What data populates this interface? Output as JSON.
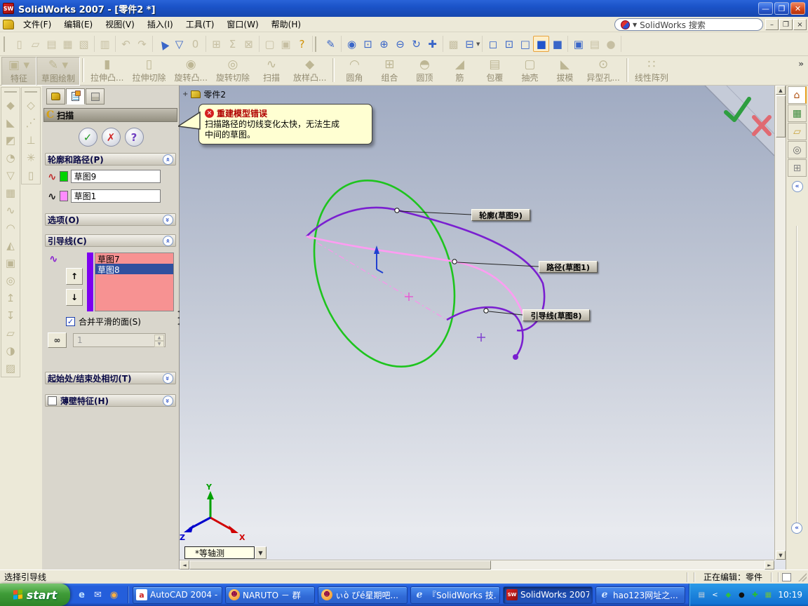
{
  "window": {
    "title": "SolidWorks 2007 - [零件2 *]",
    "logo_text": "SW"
  },
  "menubar": {
    "items": [
      "文件(F)",
      "编辑(E)",
      "视图(V)",
      "插入(I)",
      "工具(T)",
      "窗口(W)",
      "帮助(H)"
    ],
    "search_placeholder": "SolidWorks 搜索",
    "mdi_buttons": [
      "–",
      "❐",
      "×"
    ],
    "caption_buttons": [
      "–",
      "❐",
      "×"
    ]
  },
  "standard_toolbar": {
    "groups": [
      {
        "grip": true,
        "icons": [
          {
            "n": "new-document",
            "g": "▯",
            "s": "d"
          },
          {
            "n": "open",
            "g": "▱",
            "s": "d"
          },
          {
            "n": "save",
            "g": "▤",
            "s": "d"
          },
          {
            "n": "make-drawing",
            "g": "▦",
            "s": "d"
          },
          {
            "n": "make-assembly",
            "g": "▧",
            "s": "d"
          }
        ]
      },
      {
        "icons": [
          {
            "n": "print",
            "g": "▥",
            "s": "d"
          }
        ]
      },
      {
        "icons": [
          {
            "n": "undo",
            "g": "↶",
            "s": "d"
          },
          {
            "n": "redo",
            "g": "↷",
            "s": "d"
          }
        ]
      },
      {
        "icons": [
          {
            "n": "select",
            "g": "▲",
            "s": "e",
            "r": -35
          },
          {
            "n": "selection-filter",
            "g": "▽",
            "s": "e"
          },
          {
            "n": "toggle-selection-filter",
            "g": "0",
            "s": "d"
          }
        ]
      },
      {
        "icons": [
          {
            "n": "rebuild",
            "g": "⊞",
            "s": "d"
          },
          {
            "n": "equations",
            "g": "Σ",
            "s": "d"
          },
          {
            "n": "no-sketch",
            "g": "⊠",
            "s": "d"
          }
        ]
      },
      {
        "icons": [
          {
            "n": "options",
            "g": "▢",
            "s": "d"
          },
          {
            "n": "appearance",
            "g": "▣",
            "s": "d"
          },
          {
            "n": "help",
            "g": "?",
            "s": "y"
          }
        ]
      },
      {
        "grip": true,
        "icons": [
          {
            "n": "edit-color",
            "g": "✎",
            "s": "e"
          }
        ]
      },
      {
        "icons": [
          {
            "n": "zoom-to-fit",
            "g": "◉",
            "s": "e"
          },
          {
            "n": "zoom-to-area",
            "g": "⊡",
            "s": "e"
          },
          {
            "n": "zoom-in-out",
            "g": "⊕",
            "s": "e"
          },
          {
            "n": "zoom-to-selection",
            "g": "⊖",
            "s": "e"
          },
          {
            "n": "rotate-view",
            "g": "↻",
            "s": "e"
          },
          {
            "n": "pan",
            "g": "✚",
            "s": "e"
          }
        ]
      },
      {
        "icons": [
          {
            "n": "shadow",
            "g": "▩",
            "s": "d"
          },
          {
            "n": "view-orientation",
            "g": "⊟",
            "s": "e",
            "dd": true
          }
        ]
      },
      {
        "icons": [
          {
            "n": "wireframe",
            "g": "◻",
            "s": "e"
          },
          {
            "n": "hidden-lines-visible",
            "g": "⊡",
            "s": "e"
          },
          {
            "n": "hidden-lines-removed",
            "g": "□",
            "s": "e"
          },
          {
            "n": "shaded-with-edges",
            "g": "■",
            "s": "sel"
          },
          {
            "n": "shaded",
            "g": "■",
            "s": "e"
          }
        ]
      },
      {
        "icons": [
          {
            "n": "shadows-in-shaded",
            "g": "▣",
            "s": "e"
          },
          {
            "n": "appearance-book",
            "g": "▤",
            "s": "d"
          },
          {
            "n": "curvature",
            "g": "●",
            "s": "d"
          }
        ]
      }
    ]
  },
  "features_toolbar": {
    "items": [
      {
        "n": "features",
        "label": "特征",
        "g": "▣",
        "grp": true,
        "dd": true
      },
      {
        "n": "sketch",
        "label": "草图绘制",
        "g": "✎",
        "grp": true,
        "dd": true
      },
      {
        "sep": true
      },
      {
        "n": "extruded-boss",
        "label": "拉伸凸...",
        "g": "▮"
      },
      {
        "n": "extruded-cut",
        "label": "拉伸切除",
        "g": "▯"
      },
      {
        "n": "revolved-boss",
        "label": "旋转凸...",
        "g": "◉"
      },
      {
        "n": "revolved-cut",
        "label": "旋转切除",
        "g": "◎"
      },
      {
        "n": "sweep",
        "label": "扫描",
        "g": "∿"
      },
      {
        "n": "loft",
        "label": "放样凸...",
        "g": "◆"
      },
      {
        "sep": true
      },
      {
        "n": "fillet",
        "label": "圆角",
        "g": "◠"
      },
      {
        "n": "combine",
        "label": "组合",
        "g": "⊞"
      },
      {
        "n": "dome",
        "label": "圆顶",
        "g": "◓"
      },
      {
        "n": "rib",
        "label": "筋",
        "g": "◢"
      },
      {
        "n": "wrap",
        "label": "包覆",
        "g": "▤"
      },
      {
        "n": "shell",
        "label": "抽壳",
        "g": "▢"
      },
      {
        "n": "draft",
        "label": "拔模",
        "g": "◣"
      },
      {
        "n": "hole-wizard",
        "label": "异型孔...",
        "g": "⊙"
      },
      {
        "sep": true
      },
      {
        "n": "linear-pattern",
        "label": "线性阵列",
        "g": "∷"
      }
    ],
    "overflow": "»"
  },
  "left_toolbar": {
    "col1": [
      "◆",
      "◣",
      "◩",
      "◔",
      "▽",
      "▦",
      "∿",
      "◠",
      "◭",
      "▣",
      "◎",
      "↥",
      "↧",
      "▱",
      "◑",
      "▨"
    ],
    "col2": [
      "◇",
      "⋰",
      "⊥",
      "✳",
      "▯"
    ]
  },
  "property_manager": {
    "title": "扫描",
    "title_icon": "C",
    "buttons": {
      "ok": "✓",
      "cancel": "✗",
      "help": "?"
    },
    "sections": {
      "profile_path": {
        "label": "轮廓和路径(P)",
        "fields": [
          {
            "value": "草图9",
            "swatch": "#00d400"
          },
          {
            "value": "草图1",
            "swatch": "#ff8cff"
          }
        ]
      },
      "options": {
        "label": "选项(O)"
      },
      "guide_curves": {
        "label": "引导线(C)",
        "list": [
          {
            "value": "草图7",
            "selected": false
          },
          {
            "value": "草图8",
            "selected": true
          }
        ],
        "up": "↑",
        "down": "↓",
        "merge_label": "合并平滑的面(S)",
        "merge_checked": "✓",
        "spinner_value": "1"
      },
      "start_end_tangency": {
        "label": "起始处/结束处相切(T)"
      },
      "thin_feature": {
        "label": "薄壁特征(H)"
      }
    }
  },
  "graphics": {
    "tree_item": "零件2",
    "tree_expand": "+",
    "error_balloon": {
      "icon": "✕",
      "title": "重建模型错误",
      "line1": "扫描路径的切线变化太快，无法生成",
      "line2": "中间的草图。"
    },
    "callouts": [
      {
        "label": "轮廓(草图9)"
      },
      {
        "label": "路径(草图1)"
      },
      {
        "label": "引导线(草图8)"
      }
    ],
    "view_orientation": "*等轴测",
    "triad": {
      "x": "X",
      "y": "Y",
      "z": "Z"
    },
    "colors": {
      "profile": "#1ec41e",
      "path": "#ff9cf2",
      "guide": "#7a1fd0",
      "centerline": "#f49ae8"
    }
  },
  "task_pane": {
    "tabs": [
      {
        "n": "home",
        "g": "⌂",
        "c": "#b05010",
        "active": true
      },
      {
        "n": "design-library",
        "g": "▦",
        "c": "#3a8a3a"
      },
      {
        "n": "file-explorer",
        "g": "▱",
        "c": "#c8a23c"
      },
      {
        "n": "search",
        "g": "◎",
        "c": "#666666"
      },
      {
        "n": "palette",
        "g": "⊞",
        "c": "#888888"
      }
    ],
    "collapse": "«"
  },
  "status_bar": {
    "left": "选择引导线",
    "editing": "正在编辑：零件"
  },
  "taskbar": {
    "start_label": "start",
    "quick_launch": [
      {
        "n": "internet-explorer",
        "g": "e",
        "c": "#bfe0ff"
      },
      {
        "n": "mail",
        "g": "✉",
        "c": "#dfe8ff"
      },
      {
        "n": "media-player",
        "g": "◉",
        "c": "#ffb040"
      }
    ],
    "tasks": [
      {
        "label": "AutoCAD 2004 - ...",
        "icon": "autocad",
        "icon_text": "a",
        "active": false
      },
      {
        "label": "NARUTO － 群",
        "icon": "qq",
        "icon_text": "☻",
        "active": false
      },
      {
        "label": "ぃò ぴé星期吧...",
        "icon": "qq",
        "icon_text": "☻",
        "active": false
      },
      {
        "label": "『SolidWorks 技...",
        "icon": "ie",
        "icon_text": "e",
        "active": false
      },
      {
        "label": "SolidWorks 2007 ...",
        "icon": "solidworks",
        "icon_text": "SW",
        "active": true
      },
      {
        "label": "hao123网址之...",
        "icon": "ie",
        "icon_text": "e",
        "active": false
      }
    ],
    "tray_icons": [
      {
        "n": "keyboard",
        "g": "▤",
        "c": "#d8d8d8"
      },
      {
        "n": "collapse-chevron",
        "g": "<",
        "c": "#ffffff"
      },
      {
        "n": "antivirus-shield",
        "g": "◆",
        "c": "#30c040"
      },
      {
        "n": "qq-penguin",
        "g": "●",
        "c": "#101010"
      },
      {
        "n": "updater",
        "g": "✚",
        "c": "#28c028"
      },
      {
        "n": "network",
        "g": "▦",
        "c": "#70c040"
      }
    ],
    "clock": "10:19"
  }
}
